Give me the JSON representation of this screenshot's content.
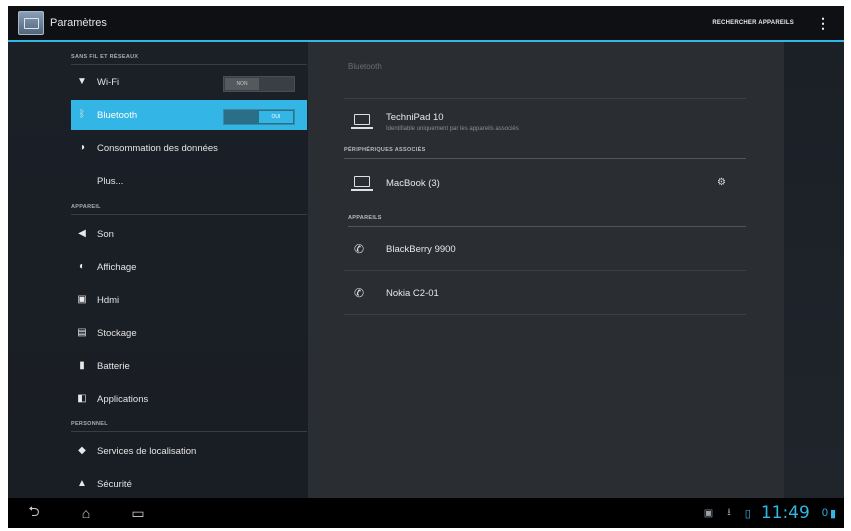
{
  "app": {
    "title": "Paramètres",
    "action": "RECHERCHER APPAREILS"
  },
  "sections": {
    "wireless": "SANS FIL ET RÉSEAUX",
    "device": "APPAREIL",
    "personal": "PERSONNEL"
  },
  "settings": {
    "wifi": {
      "label": "Wi-Fi",
      "toggle": "NON"
    },
    "bluetooth": {
      "label": "Bluetooth",
      "toggle": "OUI"
    },
    "data": {
      "label": "Consommation des données"
    },
    "more": {
      "label": "Plus..."
    },
    "sound": {
      "label": "Son"
    },
    "display": {
      "label": "Affichage"
    },
    "hdmi": {
      "label": "Hdmi"
    },
    "storage": {
      "label": "Stockage"
    },
    "battery": {
      "label": "Batterie"
    },
    "apps": {
      "label": "Applications"
    },
    "location": {
      "label": "Services de localisation"
    },
    "security": {
      "label": "Sécurité"
    }
  },
  "bluetooth_panel": {
    "header": "Bluetooth",
    "this_device": {
      "name": "TechniPad 10",
      "subtitle": "Identifiable uniquement par les appareils associés"
    },
    "paired_label": "PÉRIPHÉRIQUES ASSOCIÉS",
    "paired": [
      {
        "name": "MacBook (3)"
      }
    ],
    "devices_label": "APPAREILS",
    "available": [
      {
        "name": "BlackBerry 9900"
      },
      {
        "name": "Nokia C2-01"
      }
    ]
  },
  "statusbar": {
    "time": "11:49",
    "signal": "0"
  },
  "icons": {
    "wifi": "wifi-icon",
    "bluetooth": "bluetooth-icon",
    "data": "data-usage-icon",
    "sound": "speaker-icon",
    "display": "brightness-icon",
    "hdmi": "hdmi-icon",
    "storage": "storage-icon",
    "battery": "battery-icon",
    "apps": "apps-icon",
    "location": "location-icon",
    "security": "lock-icon",
    "back": "back-icon",
    "home": "home-icon",
    "recents": "recent-apps-icon"
  },
  "colors": {
    "accent": "#33b5e5",
    "background": "#161a20",
    "panel": "#2a2d31"
  }
}
